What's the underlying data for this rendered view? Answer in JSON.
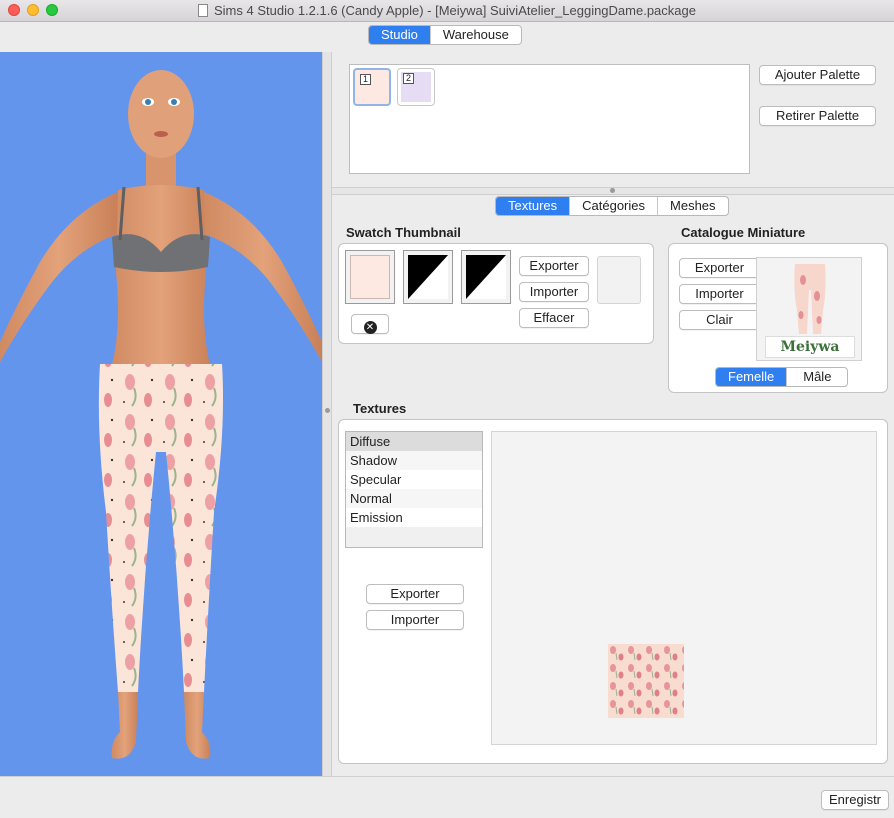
{
  "window": {
    "title": "Sims 4 Studio 1.2.1.6 (Candy Apple)  - [Meiywa] SuiviAtelier_LeggingDame.package"
  },
  "top_tabs": [
    {
      "label": "Studio",
      "active": true
    },
    {
      "label": "Warehouse",
      "active": false
    }
  ],
  "palette": {
    "items": [
      {
        "index": "1",
        "color": "#fde9e1",
        "selected": true
      },
      {
        "index": "2",
        "color": "#e6dcf3",
        "selected": false
      }
    ],
    "add_label": "Ajouter Palette",
    "remove_label": "Retirer Palette"
  },
  "sub_tabs": [
    {
      "label": "Textures",
      "active": true
    },
    {
      "label": "Catégories",
      "active": false
    },
    {
      "label": "Meshes",
      "active": false
    }
  ],
  "swatch_thumbnail": {
    "title": "Swatch Thumbnail",
    "swatch_color": "#fde9e1",
    "export_label": "Exporter",
    "import_label": "Importer",
    "clear_label": "Effacer"
  },
  "catalogue": {
    "title": "Catalogue Miniature",
    "export_label": "Exporter",
    "import_label": "Importer",
    "clear_label": "Clair",
    "thumbnail_brand": "Meiywa",
    "gender_tabs": [
      {
        "label": "Femelle",
        "active": true
      },
      {
        "label": "Mâle",
        "active": false
      }
    ]
  },
  "textures": {
    "title": "Textures",
    "list": [
      {
        "label": "Diffuse",
        "selected": true
      },
      {
        "label": "Shadow",
        "selected": false
      },
      {
        "label": "Specular",
        "selected": false
      },
      {
        "label": "Normal",
        "selected": false
      },
      {
        "label": "Emission",
        "selected": false
      }
    ],
    "export_label": "Exporter",
    "import_label": "Importer"
  },
  "footer": {
    "save_label": "Enregistr"
  },
  "colors": {
    "preview_bg": "#6495ed",
    "accent": "#2f7ff0"
  }
}
